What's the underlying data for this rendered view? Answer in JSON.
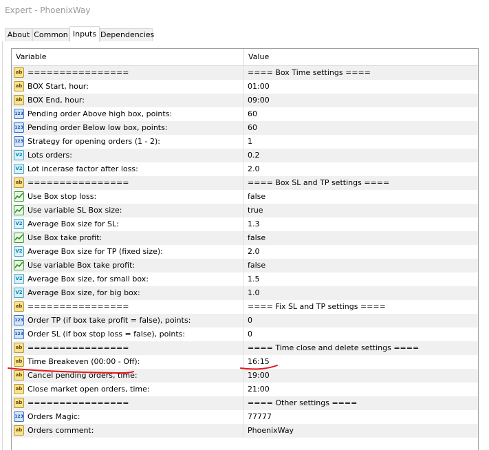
{
  "window": {
    "title": "Expert - PhoenixWay"
  },
  "tabs": [
    {
      "label": "About",
      "active": false
    },
    {
      "label": "Common",
      "active": false
    },
    {
      "label": "Inputs",
      "active": true
    },
    {
      "label": "Dependencies",
      "active": false
    }
  ],
  "table": {
    "columns": {
      "variable": "Variable",
      "value": "Value"
    },
    "rows": [
      {
        "type": "str",
        "icon": "string-type-icon",
        "label": "================",
        "value": "==== Box Time settings ===="
      },
      {
        "type": "str",
        "icon": "string-type-icon",
        "label": "BOX Start, hour:",
        "value": "01:00"
      },
      {
        "type": "str",
        "icon": "string-type-icon",
        "label": "BOX End, hour:",
        "value": "09:00"
      },
      {
        "type": "int",
        "icon": "integer-type-icon",
        "label": "Pending order Above high box, points:",
        "value": "60"
      },
      {
        "type": "int",
        "icon": "integer-type-icon",
        "label": "Pending order Below low box, points:",
        "value": "60"
      },
      {
        "type": "int",
        "icon": "integer-type-icon",
        "label": "Strategy for opening orders (1 - 2):",
        "value": "1"
      },
      {
        "type": "dbl",
        "icon": "double-type-icon",
        "label": "Lots orders:",
        "value": "0.2"
      },
      {
        "type": "dbl",
        "icon": "double-type-icon",
        "label": "Lot incerase factor after loss:",
        "value": "2.0"
      },
      {
        "type": "str",
        "icon": "string-type-icon",
        "label": "================",
        "value": "==== Box SL and TP settings ===="
      },
      {
        "type": "bool",
        "icon": "bool-type-icon",
        "label": "Use Box stop loss:",
        "value": "false"
      },
      {
        "type": "bool",
        "icon": "bool-type-icon",
        "label": "Use variable SL Box size:",
        "value": "true"
      },
      {
        "type": "dbl",
        "icon": "double-type-icon",
        "label": "Average Box size for SL:",
        "value": "1.3"
      },
      {
        "type": "bool",
        "icon": "bool-type-icon",
        "label": "Use Box take profit:",
        "value": "false"
      },
      {
        "type": "dbl",
        "icon": "double-type-icon",
        "label": "Average Box size for TP (fixed size):",
        "value": "2.0"
      },
      {
        "type": "bool",
        "icon": "bool-type-icon",
        "label": "Use variable  Box take profit:",
        "value": "false"
      },
      {
        "type": "dbl",
        "icon": "double-type-icon",
        "label": "Average Box size, for small box:",
        "value": "1.5"
      },
      {
        "type": "dbl",
        "icon": "double-type-icon",
        "label": "Average Box size, for big box:",
        "value": "1.0"
      },
      {
        "type": "str",
        "icon": "string-type-icon",
        "label": "================",
        "value": "==== Fix SL and TP settings ===="
      },
      {
        "type": "int",
        "icon": "integer-type-icon",
        "label": "Order TP (if box take profit = false), points:",
        "value": "0"
      },
      {
        "type": "int",
        "icon": "integer-type-icon",
        "label": "Order SL (if box stop loss = false), points:",
        "value": "0"
      },
      {
        "type": "str",
        "icon": "string-type-icon",
        "label": "================",
        "value": "==== Time close and delete settings ===="
      },
      {
        "type": "str",
        "icon": "string-type-icon",
        "label": "Time Breakeven (00:00 - Off):",
        "value": "16:15"
      },
      {
        "type": "str",
        "icon": "string-type-icon",
        "label": "Cancel pending orders, time:",
        "value": "19:00"
      },
      {
        "type": "str",
        "icon": "string-type-icon",
        "label": "Close market open orders, time:",
        "value": "21:00"
      },
      {
        "type": "str",
        "icon": "string-type-icon",
        "label": "================",
        "value": "==== Other settings ===="
      },
      {
        "type": "int",
        "icon": "integer-type-icon",
        "label": "Orders Magic:",
        "value": "77777"
      },
      {
        "type": "str",
        "icon": "string-type-icon",
        "label": "Orders comment:",
        "value": "PhoenixWay"
      }
    ]
  },
  "icon_glyphs": {
    "str": "ab",
    "int": "123",
    "dbl": "V2"
  },
  "colors": {
    "annotation": "#e8161b",
    "row_alt": "#f0f0f0"
  }
}
